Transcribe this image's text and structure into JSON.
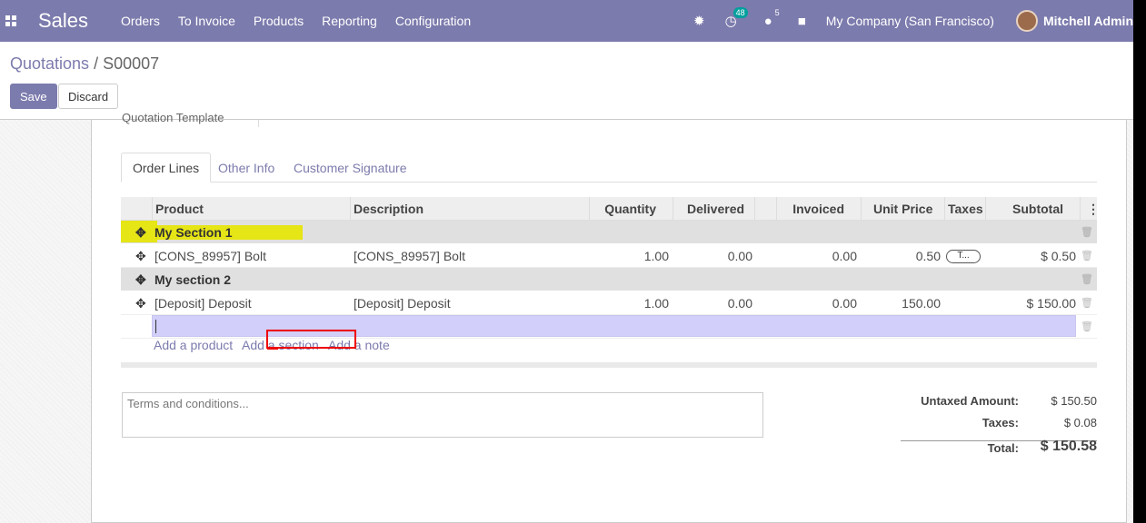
{
  "navbar": {
    "brand": "Sales",
    "menu": [
      "Orders",
      "To Invoice",
      "Products",
      "Reporting",
      "Configuration"
    ],
    "activity_count": "48",
    "messages_count": "5",
    "company": "My Company (San Francisco)",
    "user": "Mitchell Admin",
    "bg_color": "#7c7bad"
  },
  "breadcrumb": {
    "parent": "Quotations",
    "separator": " / ",
    "current": "S00007"
  },
  "buttons": {
    "save": "Save",
    "discard": "Discard"
  },
  "sheet": {
    "partial_label": "Quotation Template"
  },
  "tabs": [
    "Order Lines",
    "Other Info",
    "Customer Signature"
  ],
  "table": {
    "headers": {
      "product": "Product",
      "description": "Description",
      "quantity": "Quantity",
      "delivered": "Delivered",
      "invoiced": "Invoiced",
      "unit_price": "Unit Price",
      "taxes": "Taxes",
      "subtotal": "Subtotal"
    },
    "rows": [
      {
        "type": "section",
        "name": "My Section 1"
      },
      {
        "type": "line",
        "product": "[CONS_89957] Bolt",
        "description": "[CONS_89957] Bolt",
        "quantity": "1.00",
        "delivered": "0.00",
        "invoiced": "0.00",
        "unit_price": "0.50",
        "taxes": "T...",
        "subtotal": "$ 0.50"
      },
      {
        "type": "section",
        "name": "My section 2"
      },
      {
        "type": "line",
        "product": "[Deposit] Deposit",
        "description": "[Deposit] Deposit",
        "quantity": "1.00",
        "delivered": "0.00",
        "invoiced": "0.00",
        "unit_price": "150.00",
        "taxes": "",
        "subtotal": "$ 150.00"
      }
    ],
    "add_links": {
      "product": "Add a product",
      "section": "Add a section",
      "note": "Add a note"
    }
  },
  "terms_placeholder": "Terms and conditions...",
  "totals": {
    "untaxed_label": "Untaxed Amount:",
    "untaxed_value": "$ 150.50",
    "taxes_label": "Taxes:",
    "taxes_value": "$ 0.08",
    "total_label": "Total:",
    "total_value": "$ 150.58"
  }
}
